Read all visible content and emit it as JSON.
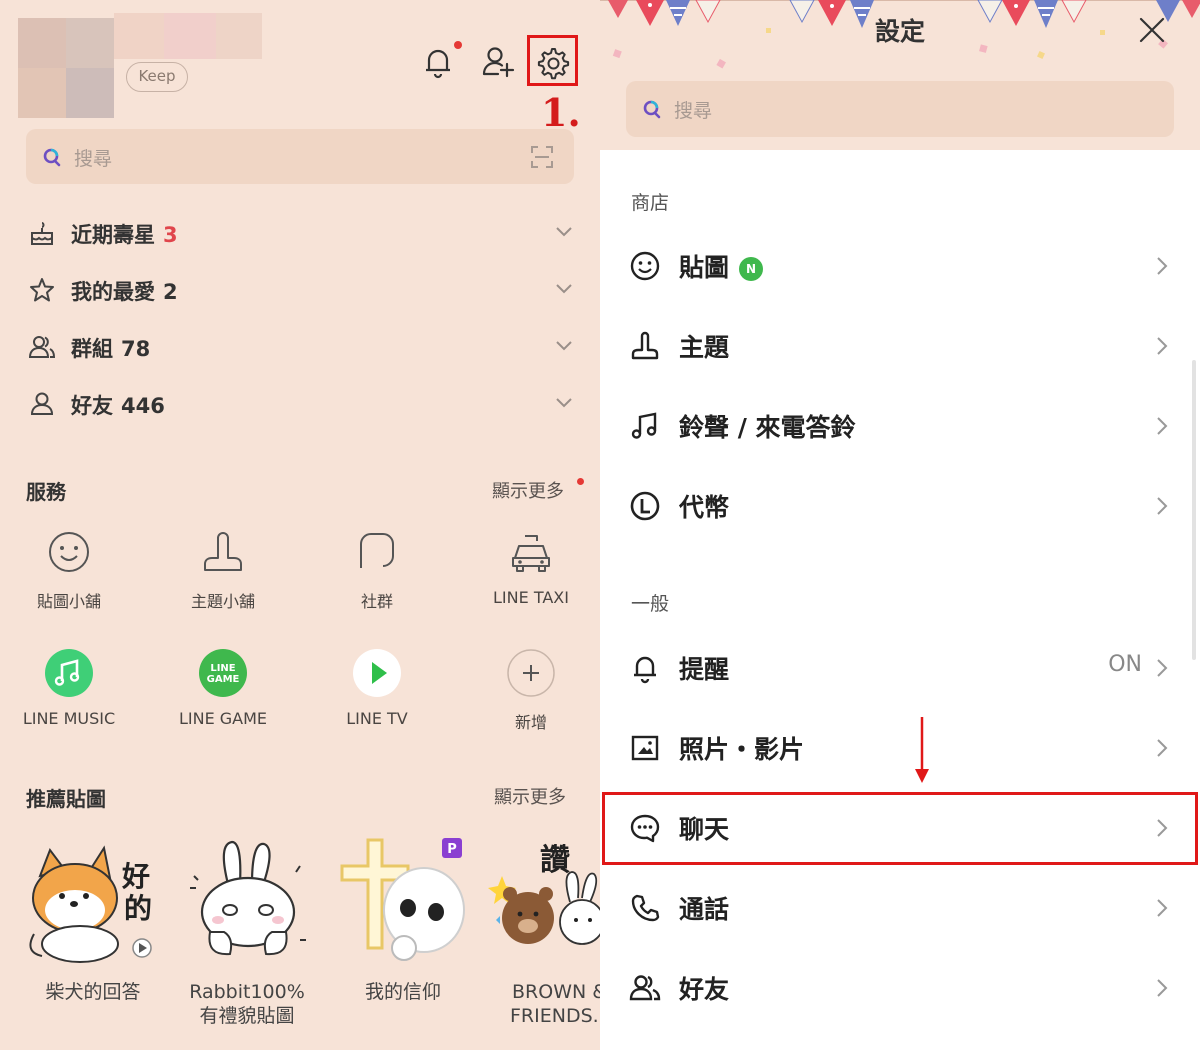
{
  "left": {
    "keep_label": "Keep",
    "step_label": "1.",
    "search": {
      "placeholder": "搜尋"
    },
    "list": [
      {
        "label": "近期壽星",
        "count": "3",
        "count_color": "#e0454b",
        "icon": "cake-icon"
      },
      {
        "label": "我的最愛",
        "count": "2",
        "count_color": "#333333",
        "icon": "star-icon"
      },
      {
        "label": "群組",
        "count": "78",
        "count_color": "#333333",
        "icon": "group-icon"
      },
      {
        "label": "好友",
        "count": "446",
        "count_color": "#333333",
        "icon": "friend-icon"
      }
    ],
    "services": {
      "title": "服務",
      "more": "顯示更多",
      "items": [
        {
          "label": "貼圖小舖",
          "icon": "smiley-icon"
        },
        {
          "label": "主題小舖",
          "icon": "brush-icon"
        },
        {
          "label": "社群",
          "icon": "openchat-icon"
        },
        {
          "label": "LINE TAXI",
          "icon": "taxi-icon"
        },
        {
          "label": "LINE MUSIC",
          "icon": "line-music-icon"
        },
        {
          "label": "LINE GAME",
          "icon": "line-game-icon"
        },
        {
          "label": "LINE TV",
          "icon": "line-tv-icon"
        },
        {
          "label": "新增",
          "icon": "add-icon"
        }
      ],
      "line_game_logo": [
        "LINE",
        "GAME"
      ]
    },
    "stickers": {
      "title": "推薦貼圖",
      "more": "顯示更多",
      "items": [
        {
          "line1": "柴犬的回答",
          "line2": "",
          "art_text": [
            "好",
            "的"
          ]
        },
        {
          "line1": "Rabbit100%",
          "line2": "有禮貌貼圖"
        },
        {
          "line1": "我的信仰",
          "line2": "",
          "badge": "P"
        },
        {
          "line1": "BROWN &",
          "line2": "FRIENDS..",
          "art_text": [
            "讚"
          ]
        }
      ]
    }
  },
  "right": {
    "title": "設定",
    "search": {
      "placeholder": "搜尋"
    },
    "sections": [
      {
        "title": "商店",
        "items": [
          {
            "label": "貼圖",
            "icon": "sticker-smiley-icon",
            "badge": "N"
          },
          {
            "label": "主題",
            "icon": "theme-brush-icon"
          },
          {
            "label": "鈴聲 / 來電答鈴",
            "icon": "music-note-icon"
          },
          {
            "label": "代幣",
            "icon": "coin-icon"
          }
        ]
      },
      {
        "title": "一般",
        "items": [
          {
            "label": "提醒",
            "icon": "bell-icon",
            "value": "ON"
          },
          {
            "label": "照片・影片",
            "icon": "photo-icon"
          },
          {
            "label": "聊天",
            "icon": "chat-icon",
            "highlighted": true
          },
          {
            "label": "通話",
            "icon": "phone-icon"
          },
          {
            "label": "好友",
            "icon": "friends-icon"
          }
        ]
      }
    ]
  },
  "colors": {
    "background_tan": "#f7e3d7",
    "search_bg": "#f0d6c5",
    "highlight_red": "#e01818",
    "line_green": "#3fb84d",
    "badge_purple": "#8a3fd1"
  }
}
